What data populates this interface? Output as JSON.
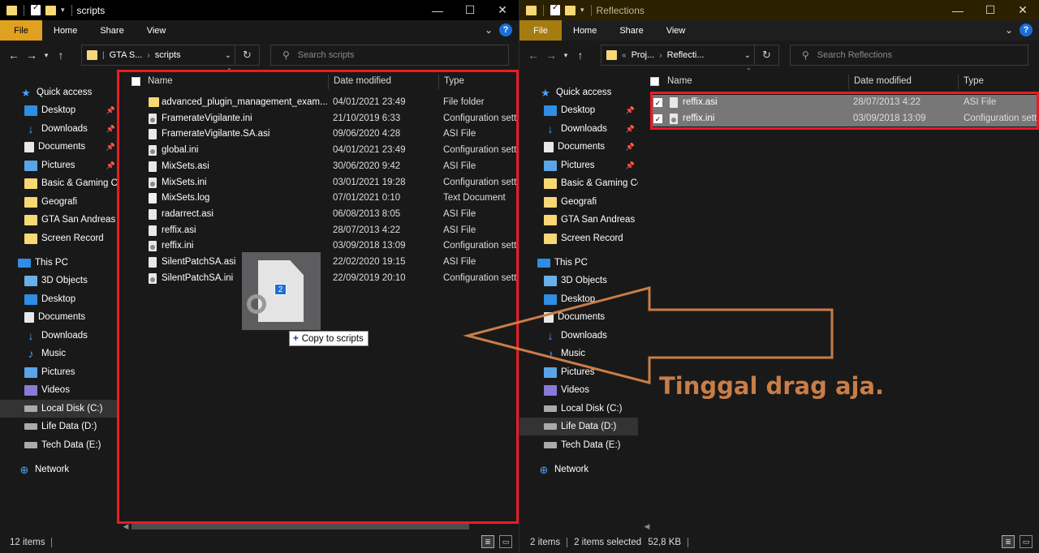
{
  "left": {
    "title": "scripts",
    "ribbon": [
      "File",
      "Home",
      "Share",
      "View"
    ],
    "address": [
      "GTA S...",
      "scripts"
    ],
    "search_placeholder": "Search scripts",
    "columns": [
      "Name",
      "Date modified",
      "Type"
    ],
    "files": [
      {
        "name": "advanced_plugin_management_exam...",
        "date": "04/01/2021 23:49",
        "type": "File folder",
        "icon": "folder-icon"
      },
      {
        "name": "FramerateVigilante.ini",
        "date": "21/10/2019 6:33",
        "type": "Configuration sett",
        "icon": "config-file-icon"
      },
      {
        "name": "FramerateVigilante.SA.asi",
        "date": "09/06/2020 4:28",
        "type": "ASI File",
        "icon": "file-icon"
      },
      {
        "name": "global.ini",
        "date": "04/01/2021 23:49",
        "type": "Configuration sett",
        "icon": "config-file-icon"
      },
      {
        "name": "MixSets.asi",
        "date": "30/06/2020 9:42",
        "type": "ASI File",
        "icon": "file-icon"
      },
      {
        "name": "MixSets.ini",
        "date": "03/01/2021 19:28",
        "type": "Configuration sett",
        "icon": "config-file-icon"
      },
      {
        "name": "MixSets.log",
        "date": "07/01/2021 0:10",
        "type": "Text Document",
        "icon": "text-file-icon"
      },
      {
        "name": "radarrect.asi",
        "date": "06/08/2013 8:05",
        "type": "ASI File",
        "icon": "file-icon"
      },
      {
        "name": "reffix.asi",
        "date": "28/07/2013 4:22",
        "type": "ASI File",
        "icon": "file-icon"
      },
      {
        "name": "reffix.ini",
        "date": "03/09/2018 13:09",
        "type": "Configuration sett",
        "icon": "config-file-icon"
      },
      {
        "name": "SilentPatchSA.asi",
        "date": "22/02/2020 19:15",
        "type": "ASI File",
        "icon": "file-icon"
      },
      {
        "name": "SilentPatchSA.ini",
        "date": "22/09/2019 20:10",
        "type": "Configuration sett",
        "icon": "config-file-icon"
      }
    ],
    "status": "12 items"
  },
  "right": {
    "title": "Reflections",
    "ribbon": [
      "File",
      "Home",
      "Share",
      "View"
    ],
    "address": [
      "Proj...",
      "Reflecti..."
    ],
    "search_placeholder": "Search Reflections",
    "columns": [
      "Name",
      "Date modified",
      "Type"
    ],
    "files": [
      {
        "name": "reffix.asi",
        "date": "28/07/2013 4:22",
        "type": "ASI File",
        "icon": "file-icon"
      },
      {
        "name": "reffix.ini",
        "date": "03/09/2018 13:09",
        "type": "Configuration sett",
        "icon": "config-file-icon"
      }
    ],
    "status": {
      "count": "2 items",
      "selected": "2 items selected",
      "size": "52,8 KB"
    }
  },
  "sidebar": {
    "quick_access": "Quick access",
    "pinned": [
      "Desktop",
      "Downloads",
      "Documents",
      "Pictures"
    ],
    "recent": [
      "Basic & Gaming Co",
      "Geografi",
      "GTA San Andreas",
      "Screen Record"
    ],
    "this_pc": "This PC",
    "pc_items": [
      "3D Objects",
      "Desktop",
      "Documents",
      "Downloads",
      "Music",
      "Pictures",
      "Videos",
      "Local Disk (C:)",
      "Life Data (D:)",
      "Tech Data (E:)"
    ],
    "network": "Network"
  },
  "drag": {
    "count": "2",
    "tooltip": "Copy to scripts"
  },
  "annotation": "Tinggal drag aja.",
  "colors": {
    "highlight_red": "#e81c24",
    "annotation_brown": "#c97d47",
    "file_tab_left": "#e0a020",
    "file_tab_right": "#a57c10"
  }
}
